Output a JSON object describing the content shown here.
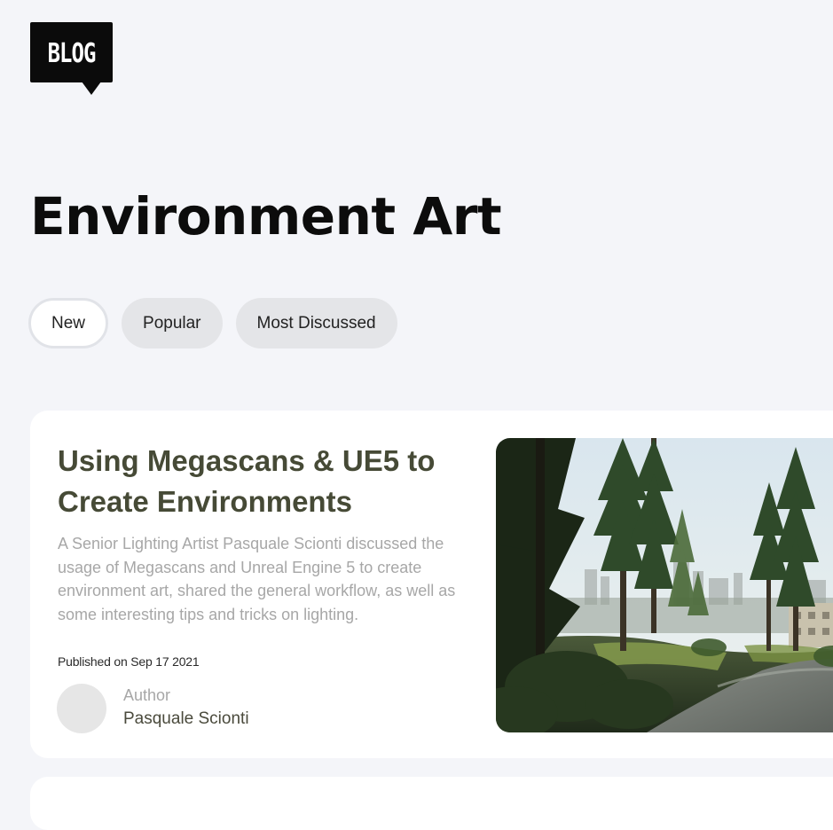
{
  "logo": {
    "text": "BLOG"
  },
  "page": {
    "title": "Environment Art"
  },
  "filters": [
    {
      "label": "New",
      "active": true
    },
    {
      "label": "Popular",
      "active": false
    },
    {
      "label": "Most Discussed",
      "active": false
    }
  ],
  "post": {
    "title": "Using Megascans & UE5 to Create Environments",
    "description": "A Senior Lighting Artist Pasquale Scionti discussed the usage of Megascans and Unreal Engine 5 to create environment art, shared the general workflow, as well as some interesting tips and tricks on lighting.",
    "published": "Published on Sep 17 2021",
    "author_label": "Author",
    "author_name": "Pasquale Scionti"
  },
  "colors": {
    "background": "#f4f5f9",
    "title": "#0c0c0c",
    "card_title": "#464a36",
    "muted_text": "#a7a7a7",
    "pill_bg": "#e4e5e8",
    "logo_bg": "#0b0b0b"
  }
}
